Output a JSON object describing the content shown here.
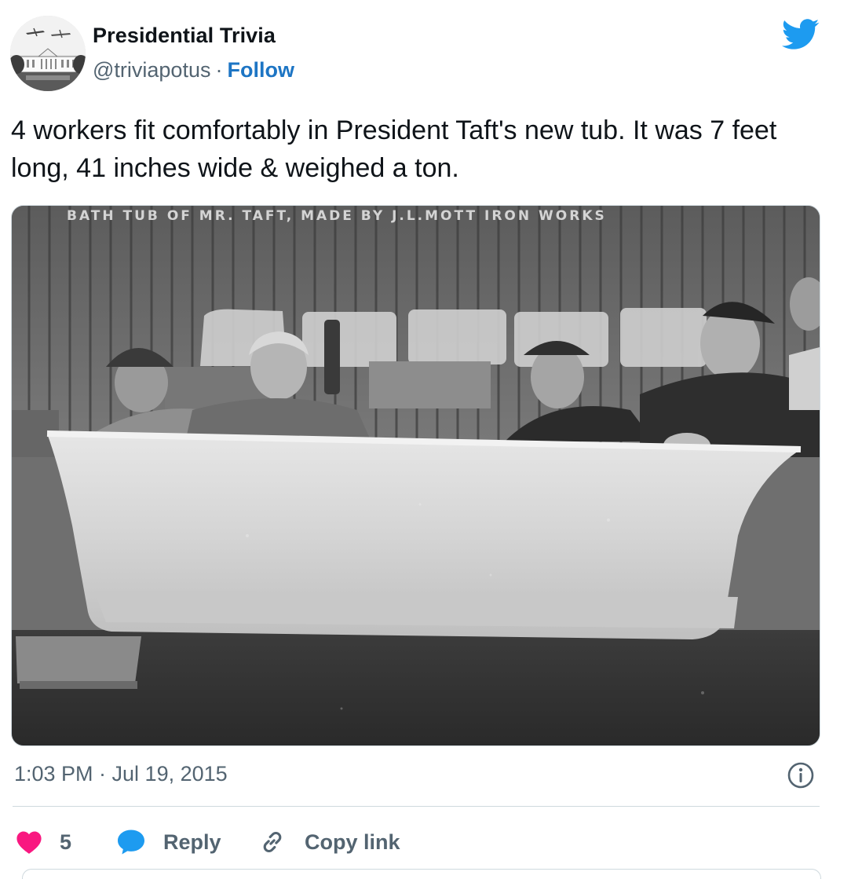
{
  "author": {
    "name": "Presidential Trivia",
    "handle": "@triviapotus",
    "separator": "·",
    "follow_label": "Follow",
    "avatar_icon": "white-house-avatar"
  },
  "brand_icon": "twitter-bird-icon",
  "tweet": {
    "text": "4 workers fit comfortably in President Taft's new tub. It was 7 feet long, 41 inches wide & weighed a ton.",
    "photo_caption": "BATH TUB OF MR. TAFT, MADE BY J.L.MOTT IRON WORKS",
    "timestamp": "1:03 PM · Jul 19, 2015"
  },
  "actions": {
    "like_count": "5",
    "reply_label": "Reply",
    "copy_label": "Copy link"
  },
  "colors": {
    "accent": "#1d9bf0",
    "follow": "#1d75c4",
    "like": "#f91880",
    "muted": "#536471",
    "text": "#0f1419"
  }
}
